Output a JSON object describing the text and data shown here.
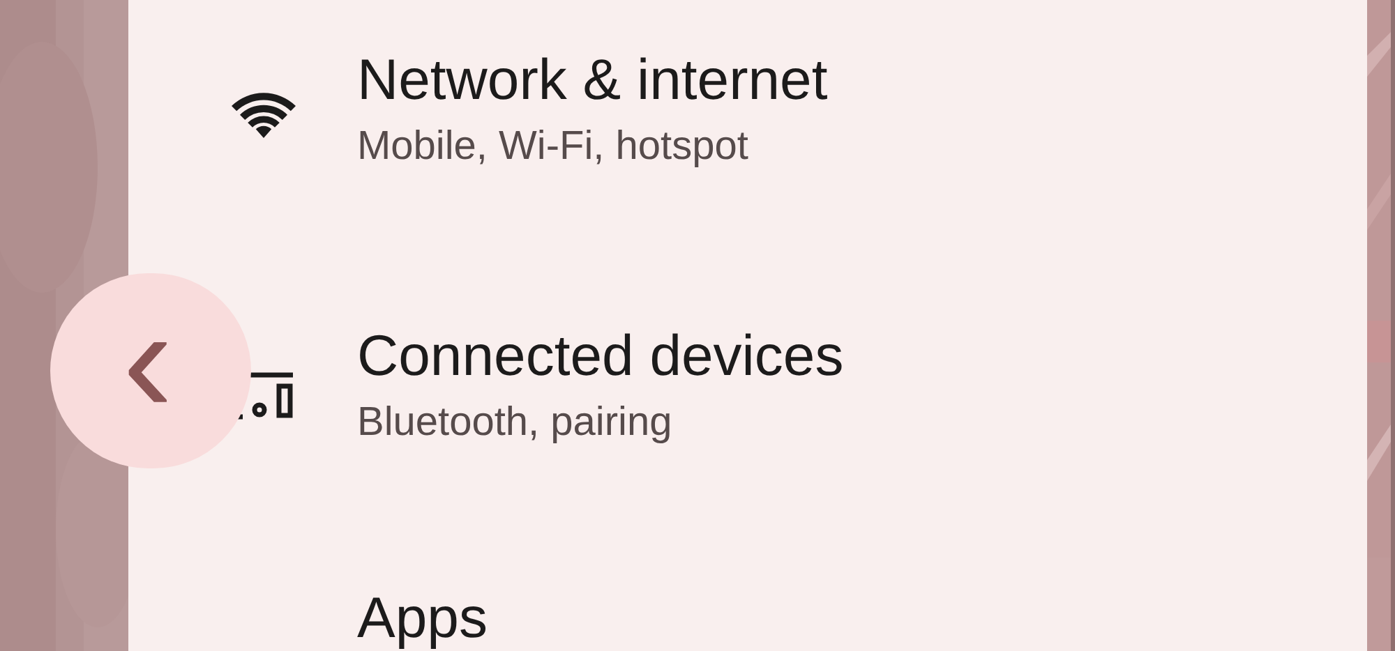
{
  "settings": [
    {
      "title": "Network & internet",
      "subtitle": "Mobile, Wi-Fi, hotspot"
    },
    {
      "title": "Connected devices",
      "subtitle": "Bluetooth, pairing"
    },
    {
      "title": "Apps"
    }
  ],
  "back_gesture": {
    "glyph": "‹"
  }
}
